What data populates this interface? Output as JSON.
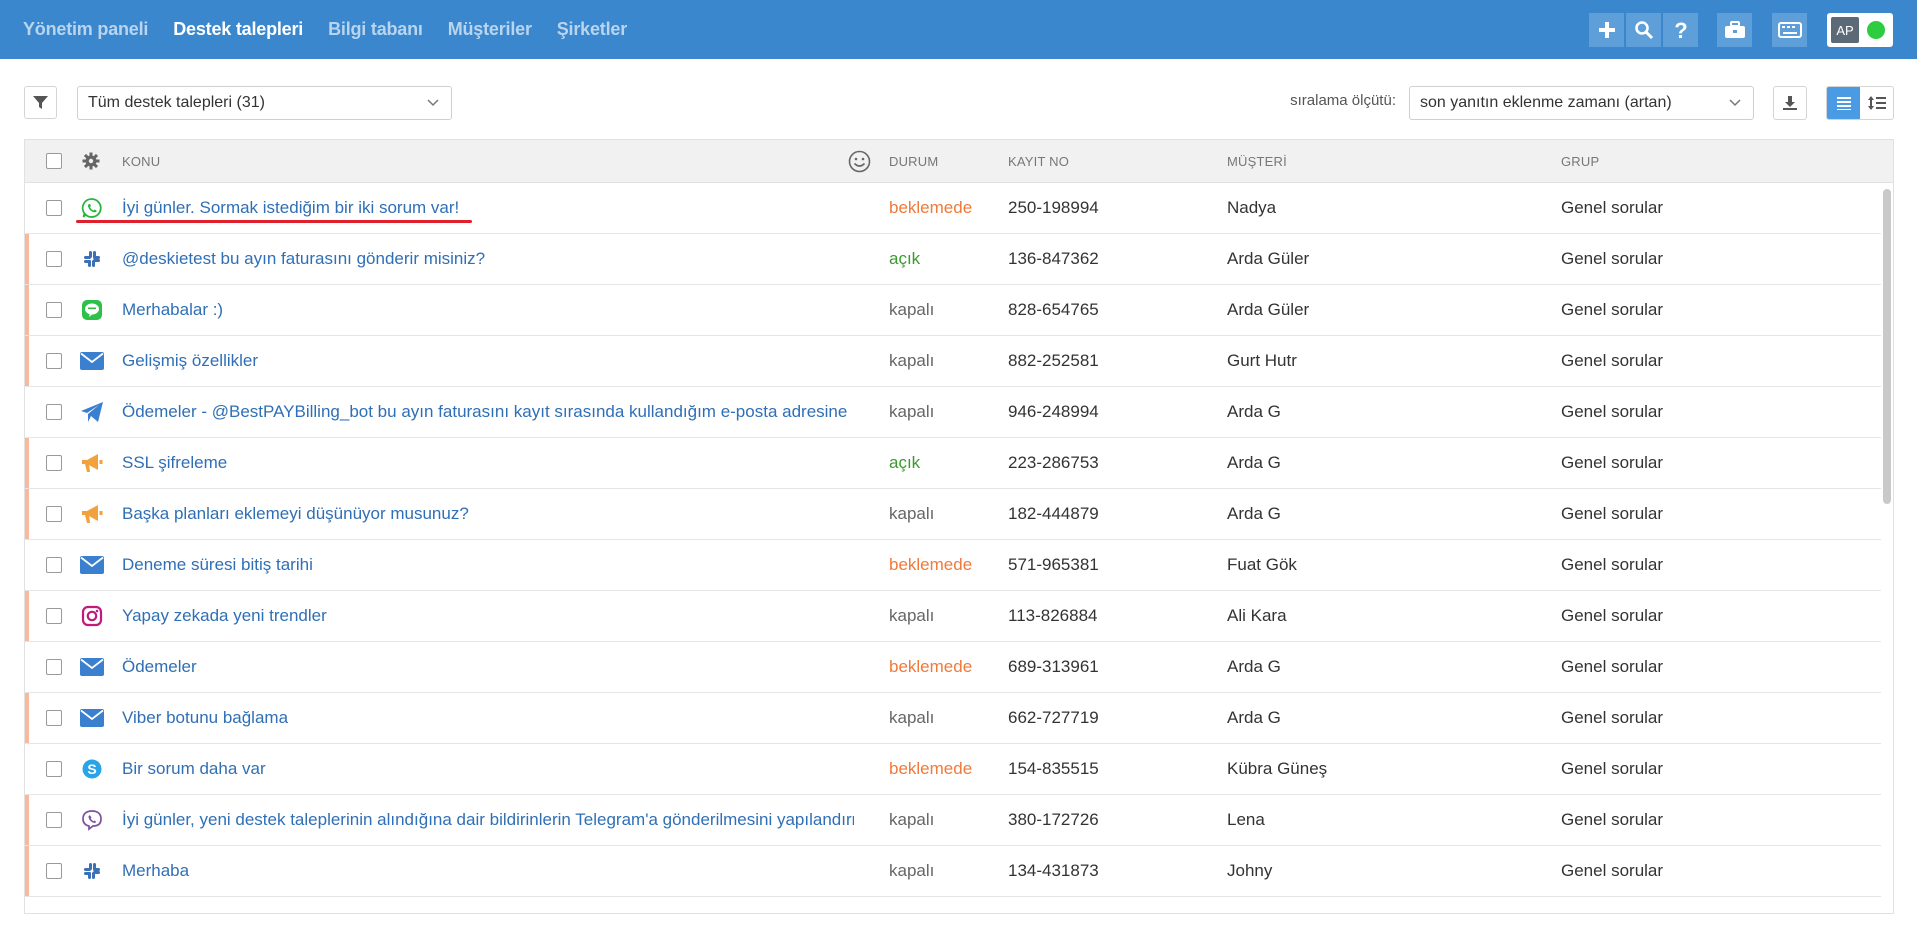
{
  "nav": {
    "items": [
      {
        "label": "Yönetim paneli",
        "active": false
      },
      {
        "label": "Destek talepleri",
        "active": true
      },
      {
        "label": "Bilgi tabanı",
        "active": false
      },
      {
        "label": "Müşteriler",
        "active": false
      },
      {
        "label": "Şirketler",
        "active": false
      }
    ]
  },
  "toolbar": {
    "icons": [
      "plus-icon",
      "search-icon",
      "help-icon",
      "briefcase-icon",
      "keyboard-icon"
    ],
    "user_initials": "AP",
    "online_color": "#2ecc40"
  },
  "filter": {
    "selected": "Tüm destek talepleri (31)",
    "sort_label": "sıralama ölçütü:",
    "sort_selected": "son yanıtın eklenme zamanı (artan)"
  },
  "table": {
    "headers": {
      "subject": "KONU",
      "status": "DURUM",
      "record_no": "KAYIT NO",
      "customer": "MÜŞTERİ",
      "group": "GRUP"
    },
    "rows": [
      {
        "channel": "whatsapp-icon",
        "subject": "İyi günler. Sormak istediğim bir iki sorum var!",
        "status": "beklemede",
        "status_kind": "beklemede",
        "record_no": "250-198994",
        "customer": "Nadya",
        "group": "Genel sorular",
        "flag": false
      },
      {
        "channel": "slack-icon",
        "subject": "@deskietest bu ayın faturasını gönderir misiniz?",
        "status": "açık",
        "status_kind": "acik",
        "record_no": "136-847362",
        "customer": "Arda Güler",
        "group": "Genel sorular",
        "flag": true
      },
      {
        "channel": "line-icon",
        "subject": "Merhabalar :)",
        "status": "kapalı",
        "status_kind": "kapali",
        "record_no": "828-654765",
        "customer": "Arda Güler",
        "group": "Genel sorular",
        "flag": true
      },
      {
        "channel": "email-icon",
        "subject": "Gelişmiş özellikler",
        "status": "kapalı",
        "status_kind": "kapali",
        "record_no": "882-252581",
        "customer": "Gurt Hutr",
        "group": "Genel sorular",
        "flag": true
      },
      {
        "channel": "telegram-icon",
        "subject": "Ödemeler - @BestPAYBilling_bot bu ayın faturasını kayıt sırasında kullandığım e-posta adresine",
        "status": "kapalı",
        "status_kind": "kapali",
        "record_no": "946-248994",
        "customer": "Arda G",
        "group": "Genel sorular",
        "flag": false
      },
      {
        "channel": "megaphone-icon",
        "subject": "SSL şifreleme",
        "status": "açık",
        "status_kind": "acik",
        "record_no": "223-286753",
        "customer": "Arda G",
        "group": "Genel sorular",
        "flag": true
      },
      {
        "channel": "megaphone-icon",
        "subject": "Başka planları eklemeyi düşünüyor musunuz?",
        "status": "kapalı",
        "status_kind": "kapali",
        "record_no": "182-444879",
        "customer": "Arda G",
        "group": "Genel sorular",
        "flag": true
      },
      {
        "channel": "email-icon",
        "subject": "Deneme süresi bitiş tarihi",
        "status": "beklemede",
        "status_kind": "beklemede",
        "record_no": "571-965381",
        "customer": "Fuat Gök",
        "group": "Genel sorular",
        "flag": false
      },
      {
        "channel": "instagram-icon",
        "subject": "Yapay zekada yeni trendler",
        "status": "kapalı",
        "status_kind": "kapali",
        "record_no": "113-826884",
        "customer": "Ali Kara",
        "group": "Genel sorular",
        "flag": true
      },
      {
        "channel": "email-icon",
        "subject": "Ödemeler",
        "status": "beklemede",
        "status_kind": "beklemede",
        "record_no": "689-313961",
        "customer": "Arda G",
        "group": "Genel sorular",
        "flag": false
      },
      {
        "channel": "email-icon",
        "subject": "Viber botunu bağlama",
        "status": "kapalı",
        "status_kind": "kapali",
        "record_no": "662-727719",
        "customer": "Arda G",
        "group": "Genel sorular",
        "flag": true
      },
      {
        "channel": "skype-icon",
        "subject": "Bir sorum daha var",
        "status": "beklemede",
        "status_kind": "beklemede",
        "record_no": "154-835515",
        "customer": "Kübra Güneş",
        "group": "Genel sorular",
        "flag": false
      },
      {
        "channel": "viber-icon",
        "subject": "İyi günler, yeni destek taleplerinin alındığına dair bildirinlerin Telegram'a gönderilmesini yapılandırmak",
        "status": "kapalı",
        "status_kind": "kapali",
        "record_no": "380-172726",
        "customer": "Lena",
        "group": "Genel sorular",
        "flag": true
      },
      {
        "channel": "slack-icon",
        "subject": "Merhaba",
        "status": "kapalı",
        "status_kind": "kapali",
        "record_no": "134-431873",
        "customer": "Johny",
        "group": "Genel sorular",
        "flag": true
      }
    ]
  }
}
